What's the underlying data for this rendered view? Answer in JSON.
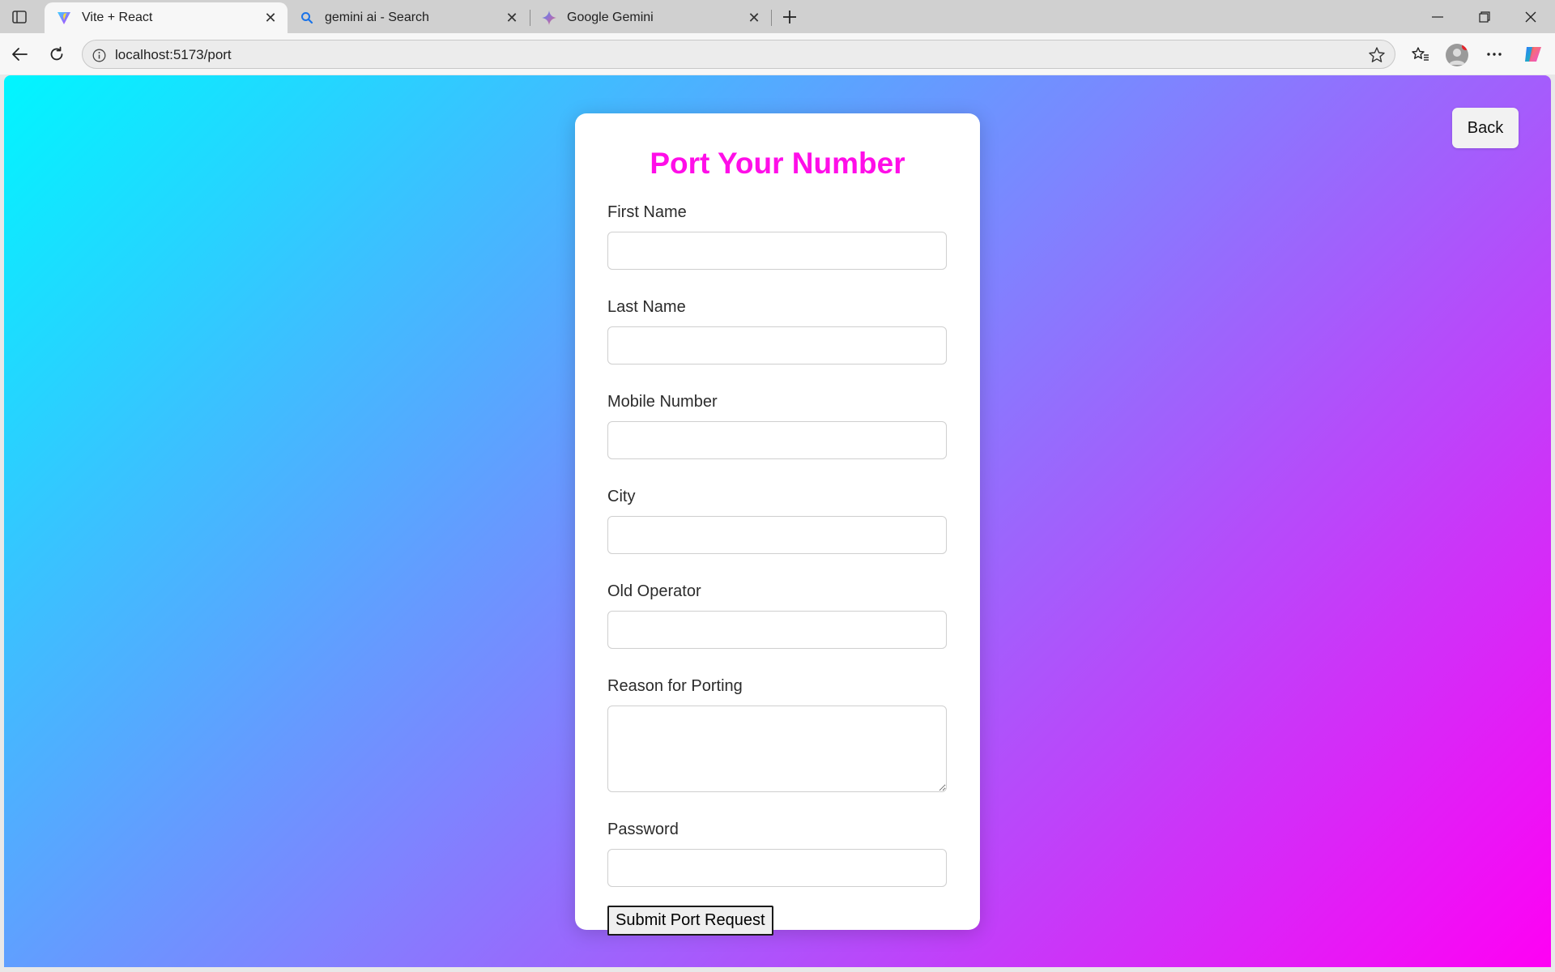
{
  "browser": {
    "tabs": [
      {
        "title": "Vite + React",
        "icon": "vite-logo-icon",
        "active": true
      },
      {
        "title": "gemini ai - Search",
        "icon": "search-icon",
        "active": false
      },
      {
        "title": "Google Gemini",
        "icon": "gemini-logo-icon",
        "active": false
      }
    ],
    "address": "localhost:5173/port"
  },
  "page": {
    "back_label": "Back",
    "title": "Port Your Number",
    "title_color": "#ff0ee8",
    "fields": [
      {
        "label": "First Name",
        "value": "",
        "type": "text"
      },
      {
        "label": "Last Name",
        "value": "",
        "type": "text"
      },
      {
        "label": "Mobile Number",
        "value": "",
        "type": "text"
      },
      {
        "label": "City",
        "value": "",
        "type": "text"
      },
      {
        "label": "Old Operator",
        "value": "",
        "type": "text"
      },
      {
        "label": "Reason for Porting",
        "value": "",
        "type": "textarea"
      },
      {
        "label": "Password",
        "value": "",
        "type": "password"
      }
    ],
    "submit_label": "Submit Port Request"
  },
  "colors": {
    "gradient_start": "#00f6ff",
    "gradient_mid": "#7e84ff",
    "gradient_end": "#ff00f4"
  }
}
